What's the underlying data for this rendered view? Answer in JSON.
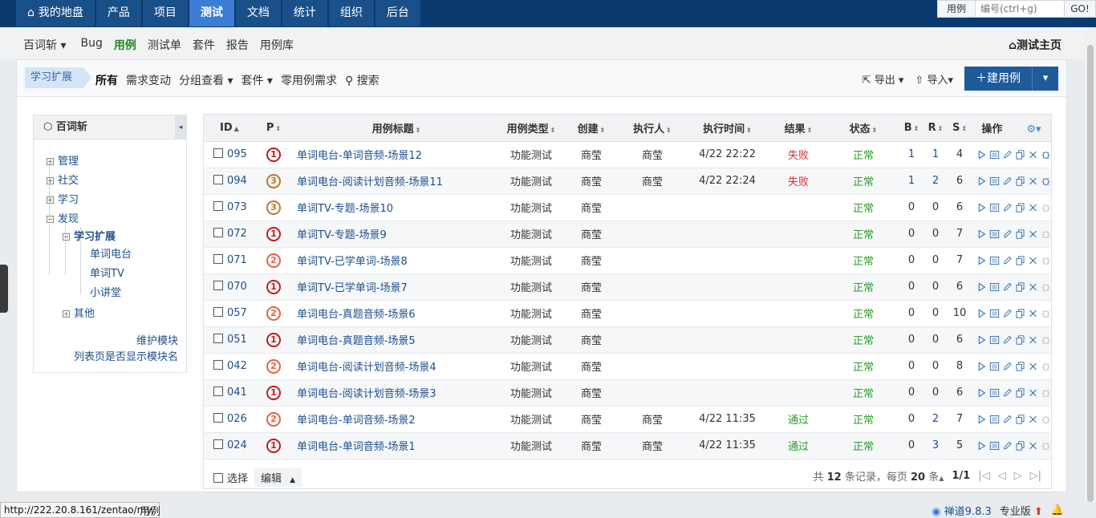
{
  "topnav": {
    "tabs": [
      {
        "label": "我的地盘",
        "icon": "home-icon",
        "active": false
      },
      {
        "label": "产品",
        "active": false
      },
      {
        "label": "项目",
        "active": false
      },
      {
        "label": "测试",
        "active": true
      },
      {
        "label": "文档",
        "active": false
      },
      {
        "label": "统计",
        "active": false
      },
      {
        "label": "组织",
        "active": false
      },
      {
        "label": "后台",
        "active": false
      }
    ],
    "search": {
      "type": "用例",
      "placeholder": "编号(ctrl+g)",
      "go": "GO!"
    }
  },
  "subnav": {
    "product": "百词斩",
    "items": [
      "Bug",
      "用例",
      "测试单",
      "套件",
      "报告",
      "用例库"
    ],
    "active": "用例",
    "home": "测试主页"
  },
  "featurebar": {
    "crumb": "学习扩展",
    "links": [
      "所有",
      "需求变动",
      "分组查看",
      "套件",
      "零用例需求",
      "搜索"
    ],
    "export": "导出",
    "import": "导入",
    "create": "建用例"
  },
  "tree": {
    "title": "百词斩",
    "nodes": [
      "管理",
      "社交",
      "学习",
      "发现",
      "学习扩展",
      "单词电台",
      "单词TV",
      "小讲堂",
      "其他"
    ],
    "maintain": "维护模块",
    "showModule": "列表页是否显示模块名"
  },
  "table": {
    "headers": [
      "ID",
      "P",
      "用例标题",
      "用例类型",
      "创建",
      "执行人",
      "执行时间",
      "结果",
      "状态",
      "B",
      "R",
      "S",
      "操作"
    ],
    "rows": [
      {
        "id": "095",
        "p": "1",
        "title": "单词电台-单词音频-场景12",
        "type": "功能测试",
        "creator": "商莹",
        "executor": "商莹",
        "time": "4/22 22:22",
        "result": "失败",
        "status": "正常",
        "b": "1",
        "r": "1",
        "s": "4"
      },
      {
        "id": "094",
        "p": "3",
        "title": "单词电台-阅读计划音频-场景11",
        "type": "功能测试",
        "creator": "商莹",
        "executor": "商莹",
        "time": "4/22 22:24",
        "result": "失败",
        "status": "正常",
        "b": "1",
        "r": "2",
        "s": "6"
      },
      {
        "id": "073",
        "p": "3",
        "title": "单词TV-专题-场景10",
        "type": "功能测试",
        "creator": "商莹",
        "executor": "",
        "time": "",
        "result": "",
        "status": "正常",
        "b": "0",
        "r": "0",
        "s": "6"
      },
      {
        "id": "072",
        "p": "1",
        "title": "单词TV-专题-场景9",
        "type": "功能测试",
        "creator": "商莹",
        "executor": "",
        "time": "",
        "result": "",
        "status": "正常",
        "b": "0",
        "r": "0",
        "s": "7"
      },
      {
        "id": "071",
        "p": "2",
        "title": "单词TV-已学单词-场景8",
        "type": "功能测试",
        "creator": "商莹",
        "executor": "",
        "time": "",
        "result": "",
        "status": "正常",
        "b": "0",
        "r": "0",
        "s": "7"
      },
      {
        "id": "070",
        "p": "1",
        "title": "单词TV-已学单词-场景7",
        "type": "功能测试",
        "creator": "商莹",
        "executor": "",
        "time": "",
        "result": "",
        "status": "正常",
        "b": "0",
        "r": "0",
        "s": "6"
      },
      {
        "id": "057",
        "p": "2",
        "title": "单词电台-真题音频-场景6",
        "type": "功能测试",
        "creator": "商莹",
        "executor": "",
        "time": "",
        "result": "",
        "status": "正常",
        "b": "0",
        "r": "0",
        "s": "10"
      },
      {
        "id": "051",
        "p": "1",
        "title": "单词电台-真题音频-场景5",
        "type": "功能测试",
        "creator": "商莹",
        "executor": "",
        "time": "",
        "result": "",
        "status": "正常",
        "b": "0",
        "r": "0",
        "s": "6"
      },
      {
        "id": "042",
        "p": "2",
        "title": "单词电台-阅读计划音频-场景4",
        "type": "功能测试",
        "creator": "商莹",
        "executor": "",
        "time": "",
        "result": "",
        "status": "正常",
        "b": "0",
        "r": "0",
        "s": "8"
      },
      {
        "id": "041",
        "p": "1",
        "title": "单词电台-阅读计划音频-场景3",
        "type": "功能测试",
        "creator": "商莹",
        "executor": "",
        "time": "",
        "result": "",
        "status": "正常",
        "b": "0",
        "r": "0",
        "s": "6"
      },
      {
        "id": "026",
        "p": "2",
        "title": "单词电台-单词音频-场景2",
        "type": "功能测试",
        "creator": "商莹",
        "executor": "商莹",
        "time": "4/22 11:35",
        "result": "通过",
        "status": "正常",
        "b": "0",
        "r": "2",
        "s": "7"
      },
      {
        "id": "024",
        "p": "1",
        "title": "单词电台-单词音频-场景1",
        "type": "功能测试",
        "creator": "商莹",
        "executor": "商莹",
        "time": "4/22 11:35",
        "result": "通过",
        "status": "正常",
        "b": "0",
        "r": "3",
        "s": "5"
      }
    ],
    "footer": {
      "select": "选择",
      "edit": "编辑",
      "total_prefix": "共",
      "total": "12",
      "total_suffix": "条记录，每页",
      "per_page": "20",
      "per_page_suffix": "条",
      "page": "1/1"
    }
  },
  "colors": {
    "p1": "#c61a1a",
    "p2": "#e8633b",
    "p3": "#b97a2a"
  },
  "statusbar": {
    "url": "http://222.20.8.161/zentao/my/",
    "crumb": "用例",
    "version": "禅道9.8.3",
    "edition": "专业版"
  }
}
